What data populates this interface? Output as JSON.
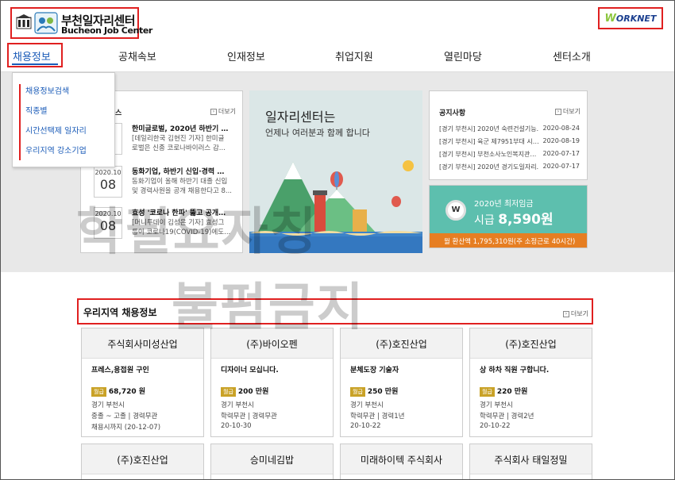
{
  "header": {
    "logo_title": "부천일자리센터",
    "logo_subtitle": "Bucheon Job Center",
    "worknet_w": "W",
    "worknet_text": "ORKNET"
  },
  "nav": {
    "items": [
      {
        "label": "채용정보",
        "active": true
      },
      {
        "label": "공채속보"
      },
      {
        "label": "인재정보"
      },
      {
        "label": "취업지원"
      },
      {
        "label": "열린마당"
      },
      {
        "label": "센터소개"
      }
    ]
  },
  "dropdown": {
    "items": [
      "채용정보검색",
      "직종별",
      "시간선택제 일자리",
      "우리지역 강소기업"
    ]
  },
  "news": {
    "header_fragment": "스",
    "more": "더보기",
    "items": [
      {
        "ym": "",
        "day": "",
        "title": "한미글로벌, 2020년 하반기 …",
        "lines": [
          "[데일리한국 김현진 기자] 한미글",
          "로벌은 신종 코로나바이러스 감..."
        ]
      },
      {
        "ym": "2020.10",
        "day": "08",
        "title": "동화기업, 하반기 신입·경력 …",
        "lines": [
          "동화기업이 올해 하반기 대졸 신입",
          "및 경력사원을 공개 채용한다고 8..."
        ]
      },
      {
        "ym": "2020.10",
        "day": "08",
        "title": "효성 '코로나 한파' 뚫고 공개…",
        "lines": [
          "[머니투데이 김성은 기자] 효성그",
          "룹이 코로나19(COVID-19)에도..."
        ]
      }
    ]
  },
  "banner": {
    "line1": "일자리센터는",
    "line2": "언제나 여러분과 함께 합니다"
  },
  "notice": {
    "title": "공지사항",
    "more": "더보기",
    "rows": [
      {
        "text": "[경기 부천시] 2020년 숙련건설기능…",
        "date": "2020-08-24"
      },
      {
        "text": "[경기 부천시] 육군 제7951부대 시…",
        "date": "2020-08-19"
      },
      {
        "text": "[경기 부천시] 부천소사노인복지관…",
        "date": "2020-07-17"
      },
      {
        "text": "[경기 부천시] 2020년 경기도일자리…",
        "date": "2020-07-17"
      }
    ]
  },
  "wage": {
    "coin": "W",
    "line1": "2020년 최저임금",
    "line2_prefix": "시급",
    "amount": "8,590원",
    "line3": "월 환산액 1,795,310원(주 소정근로 40시간)"
  },
  "watermark": {
    "line1": "학필요자칭",
    "line2": "불펌금지"
  },
  "section": {
    "title": "우리지역 채용정보",
    "more": "더보기"
  },
  "jobs": [
    {
      "company": "주식회사미성산업",
      "title": "프레스,용접원 구인",
      "pay_badge": "월급",
      "pay": "68,720 원",
      "loc": "경기 부천시",
      "req": "중졸 ~ 고졸 | 경력무관",
      "date": "채용시까지 (20-12-07)"
    },
    {
      "company": "(주)바이오펜",
      "title": "디자이너 모십니다.",
      "pay_badge": "월급",
      "pay": "200 만원",
      "loc": "경기 부천시",
      "req": "학력무관 | 경력무관",
      "date": "20-10-30"
    },
    {
      "company": "(주)호진산업",
      "title": "분체도장 기술자",
      "pay_badge": "월급",
      "pay": "250 만원",
      "loc": "경기 부천시",
      "req": "학력무관 | 경력1년",
      "date": "20-10-22"
    },
    {
      "company": "(주)호진산업",
      "title": "상 하차 직원 구합니다.",
      "pay_badge": "월급",
      "pay": "220 만원",
      "loc": "경기 부천시",
      "req": "학력무관 | 경력2년",
      "date": "20-10-22"
    }
  ],
  "jobs_row2": [
    {
      "company": "(주)호진산업"
    },
    {
      "company": "승미네김밥"
    },
    {
      "company": "미래하이텍 주식회사"
    },
    {
      "company": "주식회사 태일정밀"
    }
  ]
}
